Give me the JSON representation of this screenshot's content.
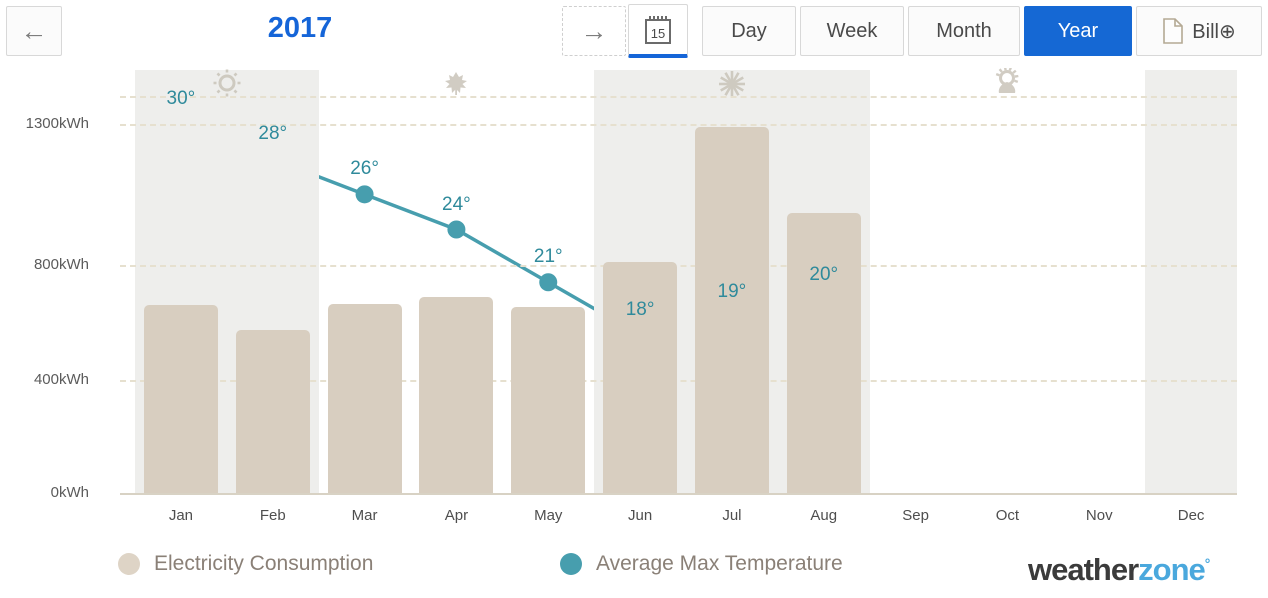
{
  "toolbar": {
    "back_icon": "arrow-left-icon",
    "forward_icon": "arrow-right-icon",
    "calendar_icon": "calendar-icon",
    "calendar_day": "15",
    "year_title": "2017",
    "ranges": [
      {
        "label": "Day",
        "active": false
      },
      {
        "label": "Week",
        "active": false
      },
      {
        "label": "Month",
        "active": false
      },
      {
        "label": "Year",
        "active": true
      }
    ],
    "bill": {
      "label": "Bill",
      "suffix": "⊕",
      "icon": "document-icon"
    },
    "accent_color": "#1568d4"
  },
  "legend": [
    {
      "label": "Electricity Consumption",
      "color": "#ded4c6"
    },
    {
      "label": "Average Max Temperature",
      "color": "#479eae"
    }
  ],
  "brand": {
    "part1": "weather",
    "part2": "zone",
    "mark": "°"
  },
  "chart_data": {
    "type": "bar",
    "title": "2017",
    "xlabel": "",
    "ylabel": "kWh",
    "grid": true,
    "legend_position": "bottom",
    "categories": [
      "Jan",
      "Feb",
      "Mar",
      "Apr",
      "May",
      "Jun",
      "Jul",
      "Aug",
      "Sep",
      "Oct",
      "Nov",
      "Dec"
    ],
    "y_ticks": [
      {
        "label": "0kWh",
        "value": 0
      },
      {
        "label": "400kWh",
        "value": 400
      },
      {
        "label": "800kWh",
        "value": 800
      },
      {
        "label": "1300kWh",
        "value": 1300
      }
    ],
    "ylim": [
      0,
      1400
    ],
    "extra_gridlines": [
      1400
    ],
    "series": [
      {
        "name": "Electricity Consumption",
        "type": "bar",
        "unit": "kWh",
        "color": "#d8cec0",
        "values": [
          660,
          575,
          665,
          690,
          655,
          810,
          1290,
          985,
          null,
          null,
          null,
          null
        ]
      },
      {
        "name": "Average Max Temperature",
        "type": "line",
        "unit": "°",
        "color": "#479eae",
        "values": [
          30,
          28,
          26,
          24,
          21,
          18,
          19,
          20,
          null,
          null,
          null,
          null
        ],
        "point_labels": [
          "30°",
          "28°",
          "26°",
          "24°",
          "21°",
          "18°",
          "19°",
          "20°"
        ]
      }
    ],
    "season_bands": [
      {
        "name": "Summer",
        "icon": "sun-icon",
        "months": [
          "Jan",
          "Feb"
        ],
        "shaded": true
      },
      {
        "name": "Autumn",
        "icon": "leaf-icon",
        "months": [
          "Mar",
          "Apr",
          "May"
        ],
        "shaded": false
      },
      {
        "name": "Winter",
        "icon": "snowflake-icon",
        "months": [
          "Jun",
          "Jul",
          "Aug"
        ],
        "shaded": true
      },
      {
        "name": "Spring",
        "icon": "flower-icon",
        "months": [
          "Sep",
          "Oct",
          "Nov"
        ],
        "shaded": false
      },
      {
        "name": "Summer",
        "icon": "",
        "months": [
          "Dec"
        ],
        "shaded": true
      }
    ]
  }
}
